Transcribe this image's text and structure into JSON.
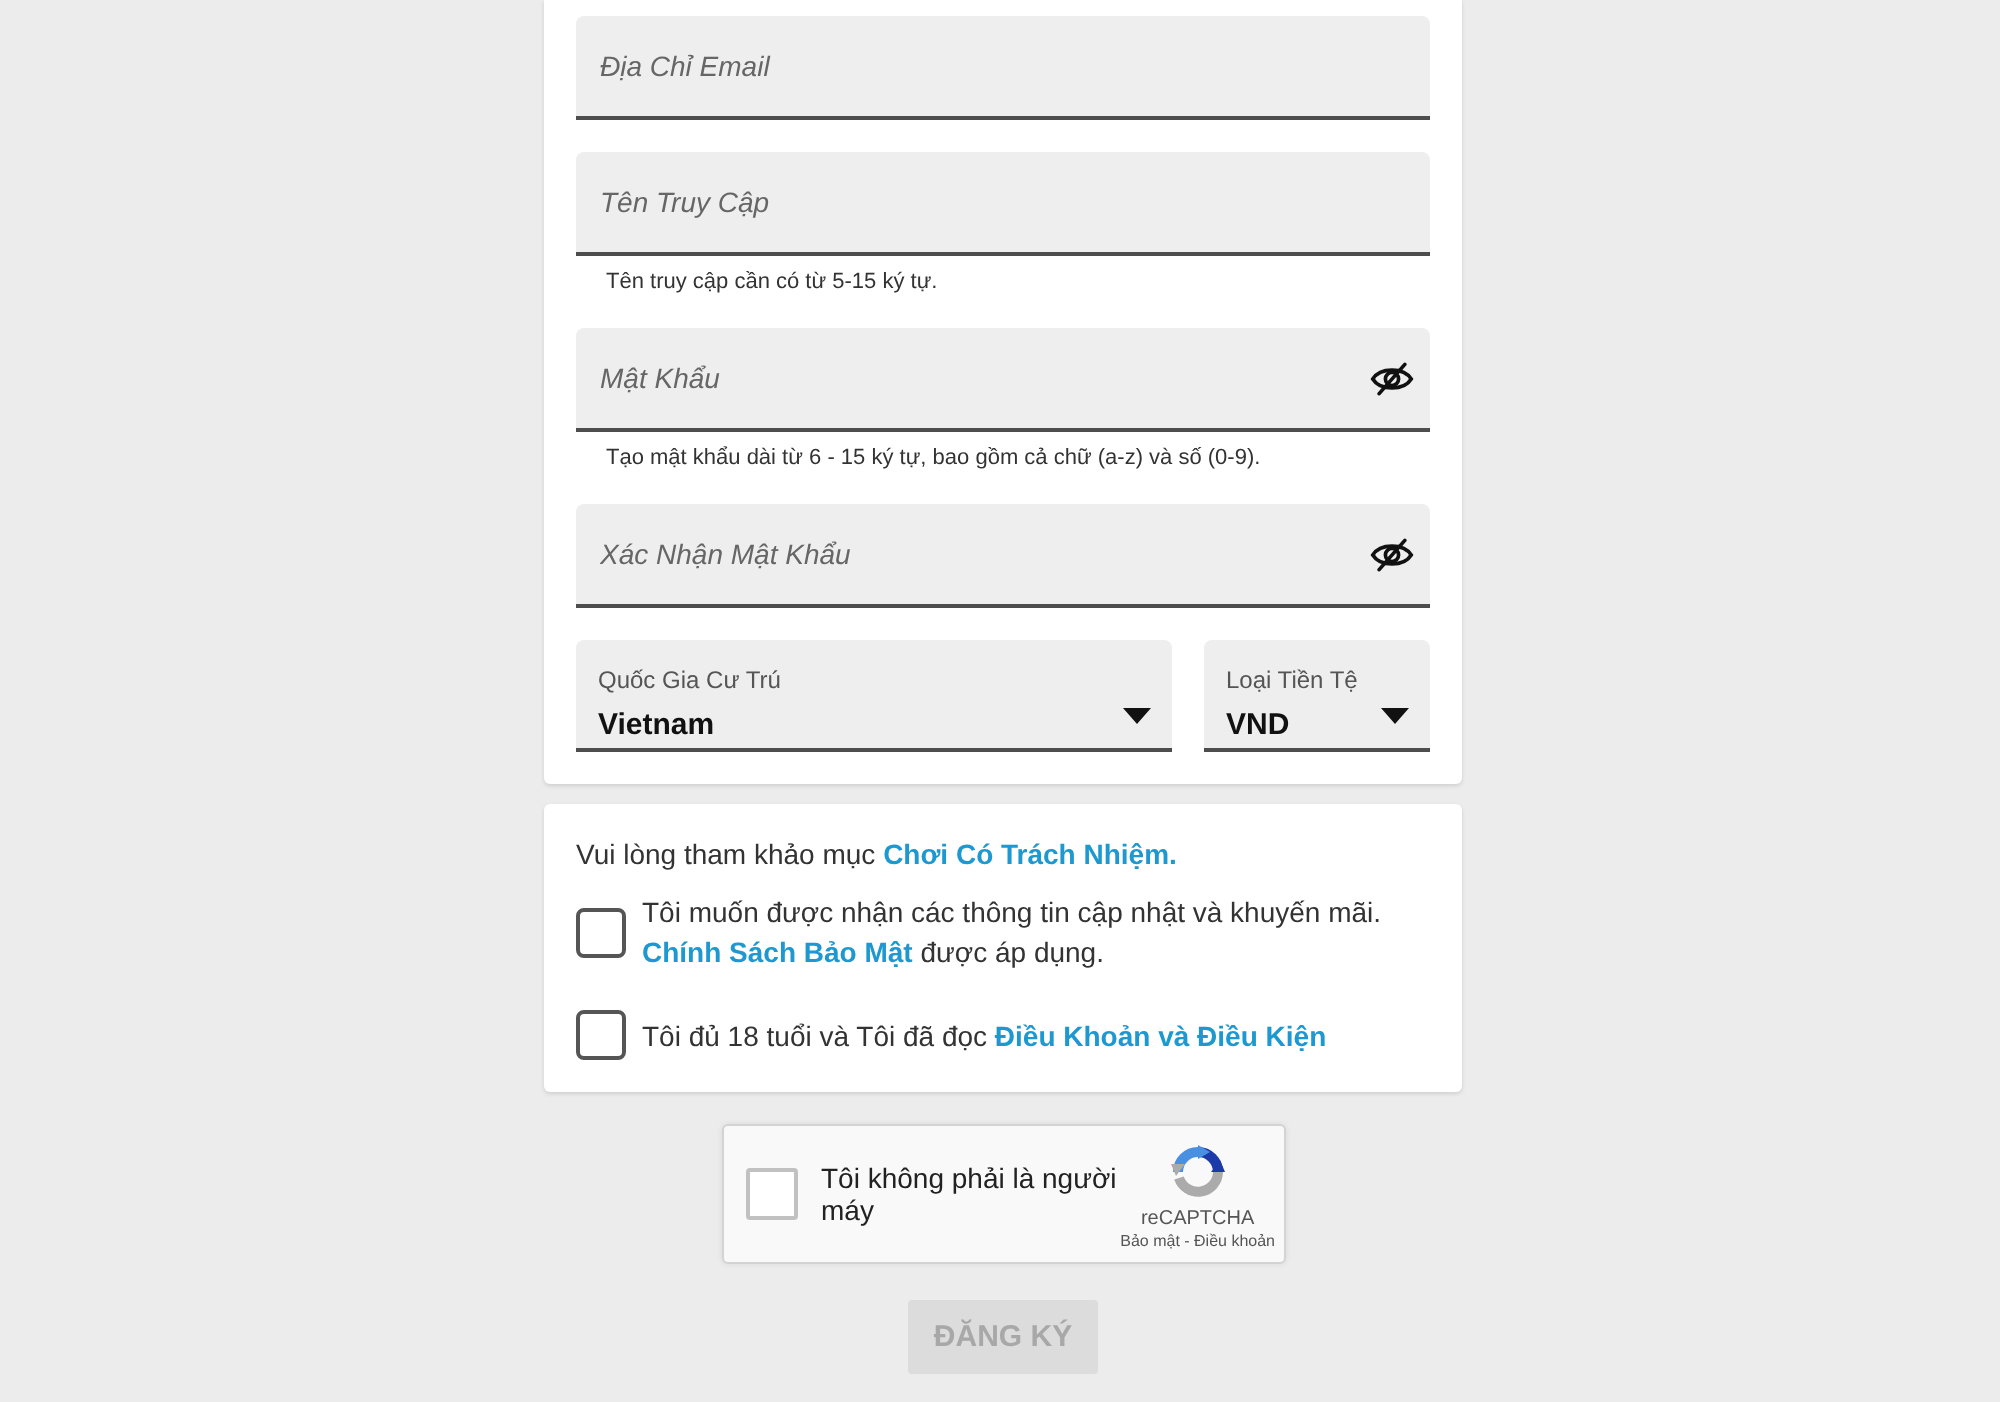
{
  "registration_form": {
    "fields": [
      {
        "kind": "text",
        "placeholder": "Địa Chỉ Email"
      },
      {
        "kind": "text",
        "placeholder": "Tên Truy Cập",
        "hint": "Tên truy cập cần có từ 5-15 ký tự."
      },
      {
        "kind": "password",
        "placeholder": "Mật Khẩu",
        "hint": "Tạo mật khẩu dài từ 6 - 15 ký tự, bao gồm cả chữ (a-z) và số (0-9)."
      },
      {
        "kind": "password",
        "placeholder": "Xác Nhận Mật Khẩu"
      }
    ],
    "dropdowns": [
      {
        "label": "Quốc Gia Cư Trú",
        "value": "Vietnam"
      },
      {
        "label": "Loại Tiền Tệ",
        "value": "VND"
      }
    ]
  },
  "consent": {
    "notice": [
      {
        "kind": "text",
        "text": "Vui lòng tham khảo mục "
      },
      {
        "kind": "link",
        "text": "Chơi Có Trách Nhiệm."
      }
    ],
    "checkboxes": [
      {
        "checked": false,
        "parts": [
          {
            "kind": "text",
            "text": "Tôi muốn được nhận các thông tin cập nhật và khuyến mãi. "
          },
          {
            "kind": "link",
            "text": "Chính Sách Bảo Mật"
          },
          {
            "kind": "text",
            "text": " được áp dụng."
          }
        ]
      },
      {
        "checked": false,
        "parts": [
          {
            "kind": "text",
            "text": "Tôi đủ 18 tuổi và Tôi đã đọc "
          },
          {
            "kind": "link",
            "text": "Điều Khoản và Điều Kiện"
          }
        ]
      }
    ]
  },
  "captcha": {
    "checked": false,
    "label": "Tôi không phải là người máy",
    "brand": "reCAPTCHA",
    "links": "Bảo mật - Điều khoản"
  },
  "submit_button": {
    "label": "ĐĂNG KÝ",
    "disabled": true
  }
}
